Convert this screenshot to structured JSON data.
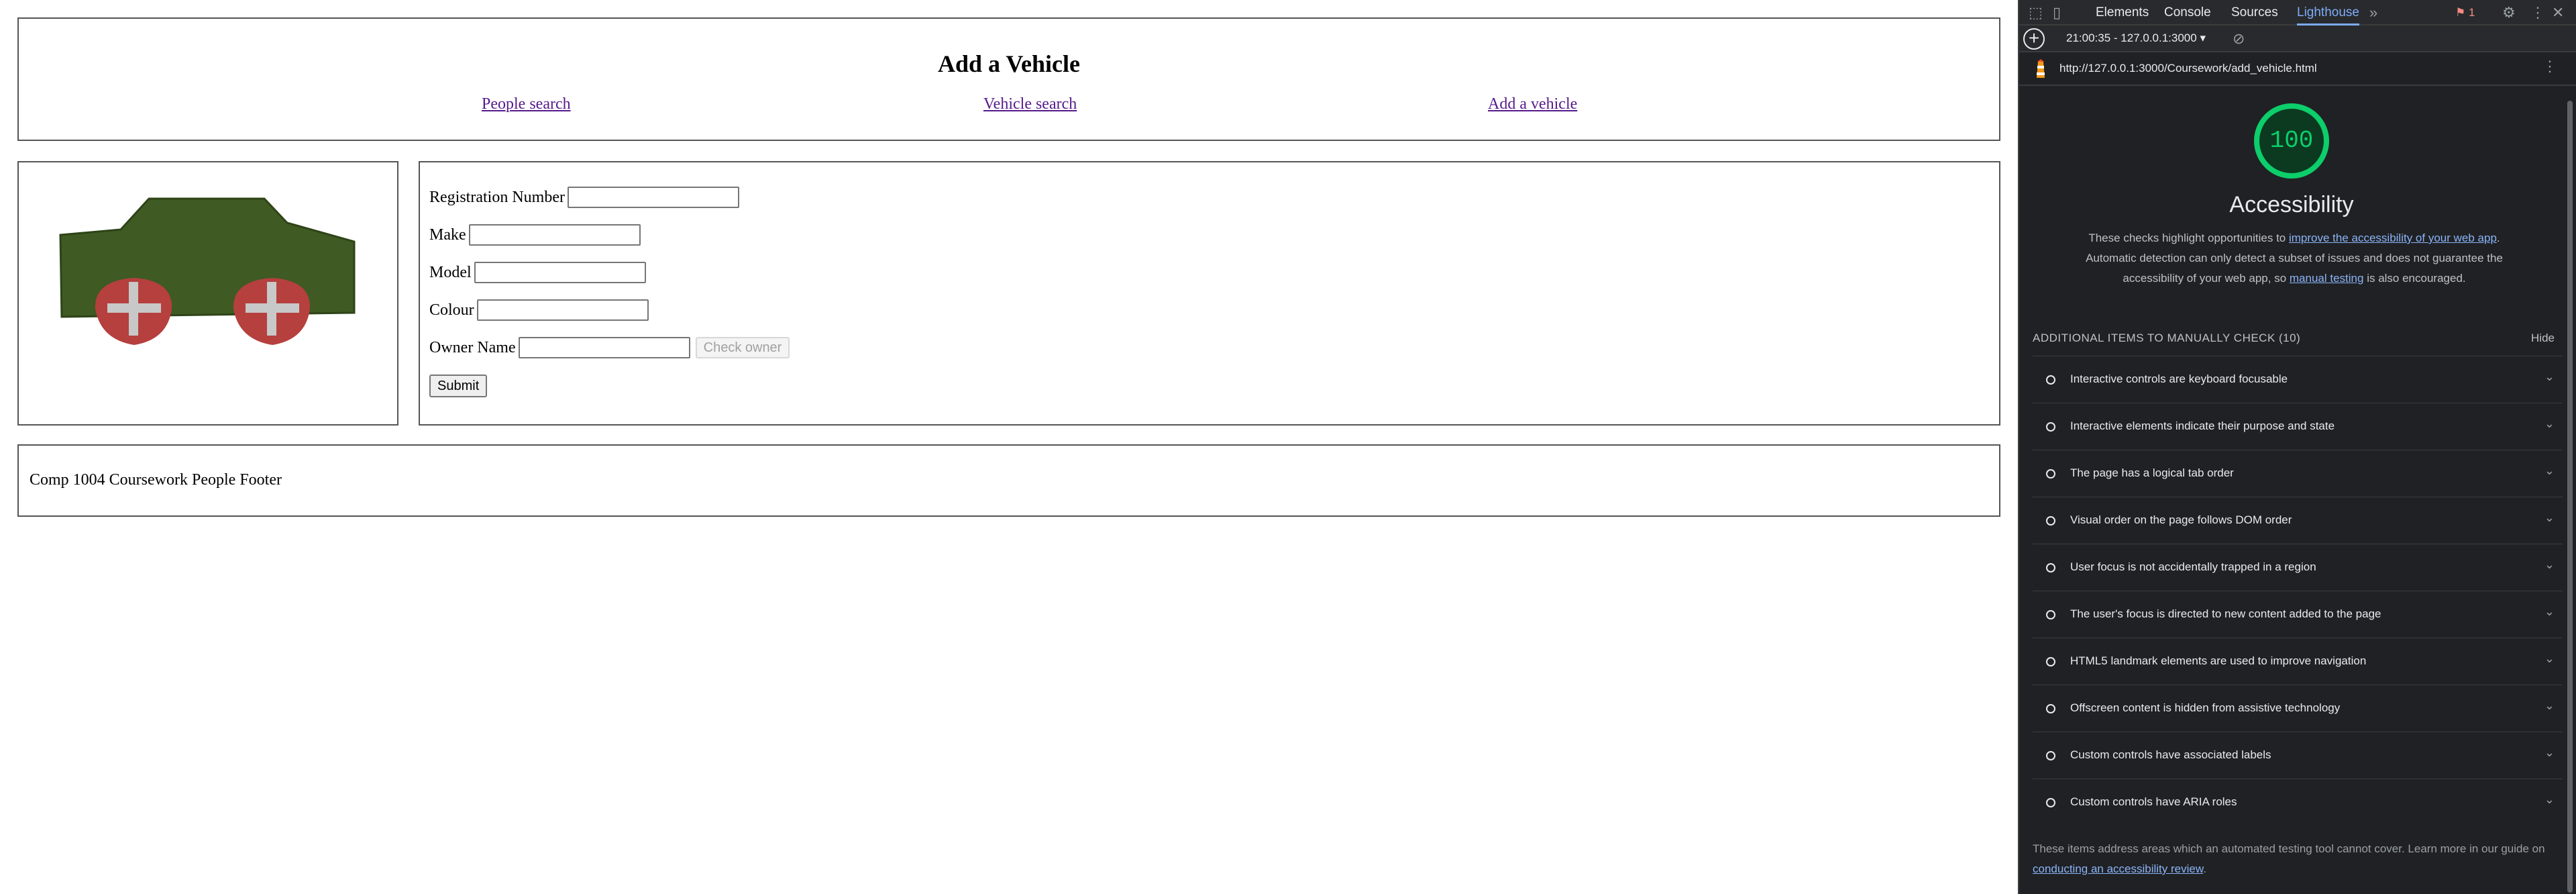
{
  "page": {
    "header": {
      "title": "Add a Vehicle",
      "nav": [
        "People search",
        "Vehicle search",
        "Add a vehicle"
      ]
    },
    "form": {
      "fields": [
        {
          "label": "Registration Number",
          "value": ""
        },
        {
          "label": "Make",
          "value": ""
        },
        {
          "label": "Model",
          "value": ""
        },
        {
          "label": "Colour",
          "value": ""
        },
        {
          "label": "Owner Name",
          "value": ""
        }
      ],
      "check_owner_label": "Check owner",
      "submit_label": "Submit"
    },
    "footer": {
      "text": "Comp 1004 Coursework People Footer"
    },
    "colors": {
      "car_body": "#3f5a23",
      "car_wheels": "#b5403e",
      "wheel_cross": "#c8c8c8",
      "link_visited": "#551a8b"
    }
  },
  "devtools": {
    "tabs": [
      "Elements",
      "Console",
      "Sources",
      "Lighthouse"
    ],
    "active_tab": "Lighthouse",
    "issues_count": "1",
    "session": "21:00:35 - 127.0.0.1:3000",
    "url": "http://127.0.0.1:3000/Coursework/add_vehicle.html",
    "score": "100",
    "category_title": "Accessibility",
    "desc_1": "These checks highlight opportunities to ",
    "desc_link_1": "improve the accessibility of your web app",
    "desc_2": ". Automatic detection can only detect a subset of issues and does not guarantee the accessibility of your web app, so ",
    "desc_link_2": "manual testing",
    "desc_3": " is also encouraged.",
    "manual_heading": "ADDITIONAL ITEMS TO MANUALLY CHECK (10)",
    "hide_label": "Hide",
    "audits": [
      "Interactive controls are keyboard focusable",
      "Interactive elements indicate their purpose and state",
      "The page has a logical tab order",
      "Visual order on the page follows DOM order",
      "User focus is not accidentally trapped in a region",
      "The user's focus is directed to new content added to the page",
      "HTML5 landmark elements are used to improve navigation",
      "Offscreen content is hidden from assistive technology",
      "Custom controls have associated labels",
      "Custom controls have ARIA roles"
    ],
    "note_1": "These items address areas which an automated testing tool cannot cover. Learn more in our guide on ",
    "note_link": "conducting an accessibility review",
    "note_2": ".",
    "score_color": "#0cce6b"
  }
}
